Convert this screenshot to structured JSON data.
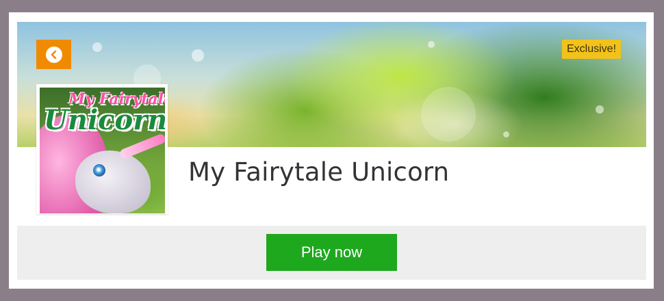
{
  "header": {
    "back_button": {
      "icon": "chevron-left-icon",
      "color": "#f08a00"
    },
    "badge": {
      "label": "Exclusive!",
      "color": "#f2c21a"
    }
  },
  "game": {
    "title": "My Fairytale Unicorn",
    "thumbnail": {
      "logo_line1": "My Fairytale",
      "logo_line2": "Unicorn"
    }
  },
  "actions": {
    "play_label": "Play now",
    "play_color": "#1ea81e"
  }
}
